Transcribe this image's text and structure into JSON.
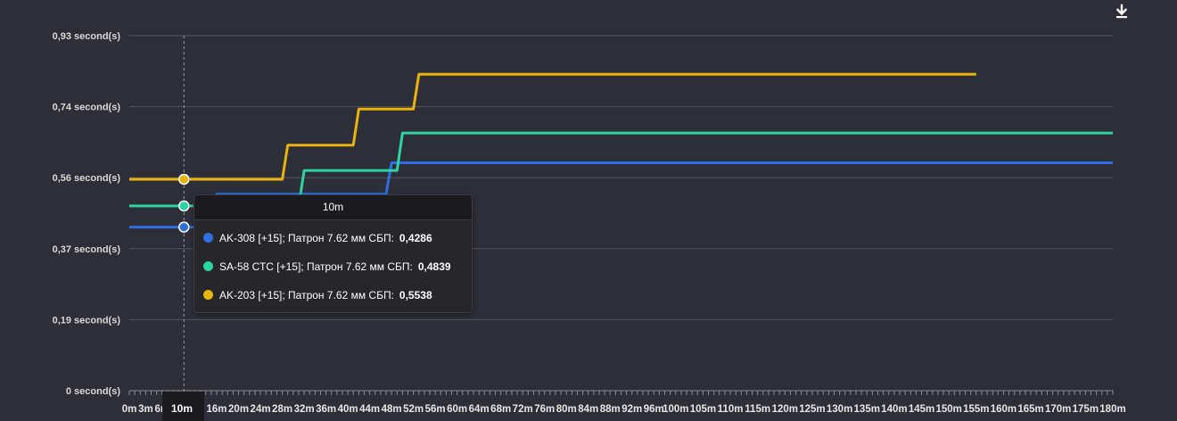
{
  "toolbar": {
    "download_icon": "download-icon"
  },
  "colors": {
    "background": "#2e2e38",
    "grid": "#55555f",
    "ak308": "#2f6fe0",
    "sa58": "#2bd4a0",
    "ak203": "#e8b40c"
  },
  "chart_data": {
    "type": "line",
    "title": "",
    "xlabel": "",
    "ylabel": "",
    "y_tick_labels": [
      "0 second(s)",
      "0,19 second(s)",
      "0,37 second(s)",
      "0,56 second(s)",
      "0,74 second(s)",
      "0,93 second(s)"
    ],
    "y_ticks": [
      0,
      0.186,
      0.372,
      0.558,
      0.744,
      0.93
    ],
    "ylim": [
      0,
      0.93
    ],
    "x_ticks": [
      0,
      3,
      6,
      10,
      16,
      20,
      24,
      28,
      32,
      36,
      40,
      44,
      48,
      52,
      56,
      60,
      64,
      68,
      72,
      76,
      80,
      84,
      88,
      92,
      96,
      100,
      105,
      110,
      115,
      120,
      125,
      130,
      135,
      140,
      145,
      150,
      155,
      160,
      165,
      170,
      175,
      180
    ],
    "x_tick_labels": [
      "0m",
      "3m",
      "6m",
      "10m",
      "16m",
      "20m",
      "24m",
      "28m",
      "32m",
      "36m",
      "40m",
      "44m",
      "48m",
      "52m",
      "56m",
      "60m",
      "64m",
      "68m",
      "72m",
      "76m",
      "80m",
      "84m",
      "88m",
      "92m",
      "96m",
      "100m",
      "105m",
      "110m",
      "115m",
      "120m",
      "125m",
      "130m",
      "135m",
      "140m",
      "145m",
      "150m",
      "155m",
      "160m",
      "165m",
      "170m",
      "175m",
      "180m"
    ],
    "grid": true,
    "hover_x": 10,
    "series": [
      {
        "name": "AK-308 [+15]; Патрон 7.62 мм СБП:",
        "color": "#2f6fe0",
        "points": [
          [
            0,
            0.4286
          ],
          [
            15,
            0.4286
          ],
          [
            16,
            0.515
          ],
          [
            47,
            0.515
          ],
          [
            48,
            0.597
          ],
          [
            180,
            0.597
          ]
        ],
        "hover_value": "0,4286"
      },
      {
        "name": "SA-58 СТС [+15]; Патрон 7.62 мм СБП:",
        "color": "#2bd4a0",
        "points": [
          [
            0,
            0.4839
          ],
          [
            31,
            0.4839
          ],
          [
            32,
            0.577
          ],
          [
            49,
            0.577
          ],
          [
            50,
            0.675
          ],
          [
            180,
            0.675
          ]
        ],
        "hover_value": "0,4839"
      },
      {
        "name": "AK-203 [+15]; Патрон 7.62 мм СБП:",
        "color": "#e8b40c",
        "points": [
          [
            0,
            0.5538
          ],
          [
            28,
            0.5538
          ],
          [
            29,
            0.643
          ],
          [
            41,
            0.643
          ],
          [
            42,
            0.738
          ],
          [
            52,
            0.738
          ],
          [
            53,
            0.829
          ],
          [
            155,
            0.829
          ]
        ],
        "hover_value": "0,5538"
      }
    ]
  },
  "tooltip": {
    "title": "10m",
    "rows": [
      {
        "label": "AK-308 [+15]; Патрон 7.62 мм СБП:",
        "value": "0,4286",
        "color": "#2f6fe0"
      },
      {
        "label": "SA-58 СТС [+15]; Патрон 7.62 мм СБП:",
        "value": "0,4839",
        "color": "#2bd4a0"
      },
      {
        "label": "AK-203 [+15]; Патрон 7.62 мм СБП:",
        "value": "0,5538",
        "color": "#e8b40c"
      }
    ]
  },
  "x_highlight_label": "10m"
}
